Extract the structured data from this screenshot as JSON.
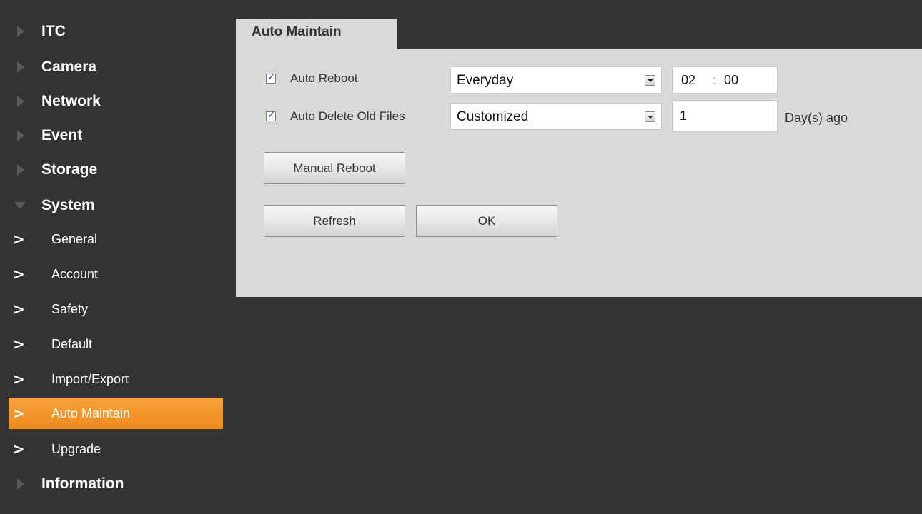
{
  "sidebar": {
    "top_items": [
      {
        "label": "ITC"
      },
      {
        "label": "Camera"
      },
      {
        "label": "Network"
      },
      {
        "label": "Event"
      },
      {
        "label": "Storage"
      },
      {
        "label": "System"
      },
      {
        "label": "Information"
      }
    ],
    "system_sub_items": [
      {
        "label": "General"
      },
      {
        "label": "Account"
      },
      {
        "label": "Safety"
      },
      {
        "label": "Default"
      },
      {
        "label": "Import/Export"
      },
      {
        "label": "Auto Maintain"
      },
      {
        "label": "Upgrade"
      }
    ],
    "active_item": "Auto Maintain",
    "active_color": "#f4982b"
  },
  "panel": {
    "tab_title": "Auto Maintain",
    "auto_reboot": {
      "label": "Auto Reboot",
      "checked": true,
      "schedule_value": "Everyday",
      "hour": "02",
      "separator": ":",
      "minute": "00"
    },
    "auto_delete": {
      "label": "Auto Delete Old Files",
      "checked": true,
      "mode_value": "Customized",
      "days_value": "1",
      "unit_label": "Day(s) ago"
    },
    "buttons": {
      "manual_reboot": "Manual Reboot",
      "refresh": "Refresh",
      "ok": "OK"
    }
  }
}
